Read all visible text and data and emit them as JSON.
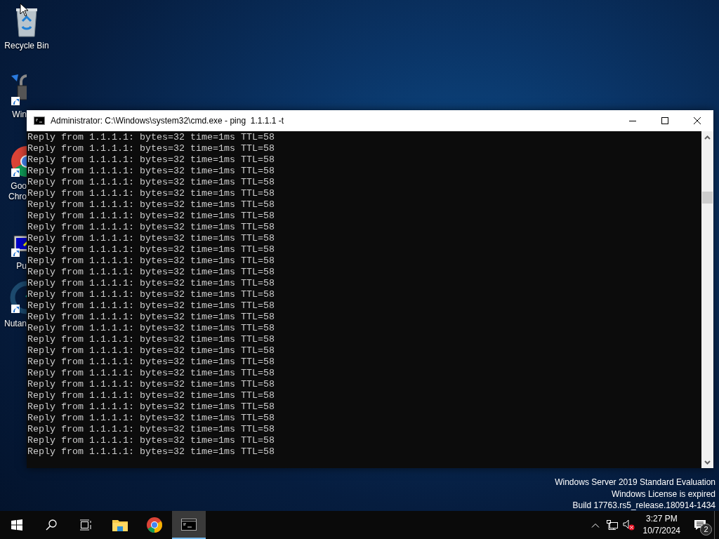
{
  "desktop_icons": [
    {
      "kind": "recycle-bin",
      "shortcut": false,
      "lines": [
        "Recycle Bin"
      ]
    },
    {
      "kind": "lock-transfer",
      "shortcut": true,
      "lines": [
        "Win"
      ]
    },
    {
      "kind": "browser",
      "shortcut": true,
      "lines": [
        "Goo",
        "Chro"
      ]
    },
    {
      "kind": "terminal-client",
      "shortcut": true,
      "lines": [
        "Pu"
      ]
    },
    {
      "kind": "ring",
      "shortcut": true,
      "lines": [
        "Nutan"
      ]
    }
  ],
  "window": {
    "title": "Administrator: C:\\Windows\\system32\\cmd.exe - ping  1.1.1.1 -t",
    "lines": [
      "Reply from 1.1.1.1: bytes=32 time=1ms TTL=58",
      "Reply from 1.1.1.1: bytes=32 time=1ms TTL=58",
      "Reply from 1.1.1.1: bytes=32 time=1ms TTL=58",
      "Reply from 1.1.1.1: bytes=32 time=1ms TTL=58",
      "Reply from 1.1.1.1: bytes=32 time=1ms TTL=58",
      "Reply from 1.1.1.1: bytes=32 time=1ms TTL=58",
      "Reply from 1.1.1.1: bytes=32 time=1ms TTL=58",
      "Reply from 1.1.1.1: bytes=32 time=1ms TTL=58",
      "Reply from 1.1.1.1: bytes=32 time=1ms TTL=58",
      "Reply from 1.1.1.1: bytes=32 time=1ms TTL=58",
      "Reply from 1.1.1.1: bytes=32 time=1ms TTL=58",
      "Reply from 1.1.1.1: bytes=32 time=1ms TTL=58",
      "Reply from 1.1.1.1: bytes=32 time=1ms TTL=58",
      "Reply from 1.1.1.1: bytes=32 time=1ms TTL=58",
      "Reply from 1.1.1.1: bytes=32 time=1ms TTL=58",
      "Reply from 1.1.1.1: bytes=32 time=1ms TTL=58",
      "Reply from 1.1.1.1: bytes=32 time=1ms TTL=58",
      "Reply from 1.1.1.1: bytes=32 time=1ms TTL=58",
      "Reply from 1.1.1.1: bytes=32 time=1ms TTL=58",
      "Reply from 1.1.1.1: bytes=32 time=1ms TTL=58",
      "Reply from 1.1.1.1: bytes=32 time=1ms TTL=58",
      "Reply from 1.1.1.1: bytes=32 time=1ms TTL=58",
      "Reply from 1.1.1.1: bytes=32 time=1ms TTL=58",
      "Reply from 1.1.1.1: bytes=32 time=1ms TTL=58",
      "Reply from 1.1.1.1: bytes=32 time=1ms TTL=58",
      "Reply from 1.1.1.1: bytes=32 time=1ms TTL=58",
      "Reply from 1.1.1.1: bytes=32 time=1ms TTL=58",
      "Reply from 1.1.1.1: bytes=32 time=1ms TTL=58",
      "Reply from 1.1.1.1: bytes=32 time=1ms TTL=58"
    ]
  },
  "desktop_notice": [
    "Windows Server 2019 Standard Evaluation",
    "Windows License is expired",
    "Build 17763.rs5_release.180914-1434"
  ],
  "taskbar": {
    "buttons": [
      {
        "kind": "start",
        "selected": false
      },
      {
        "kind": "search",
        "selected": false
      },
      {
        "kind": "task-view",
        "selected": false
      },
      {
        "kind": "folder",
        "selected": false
      },
      {
        "kind": "browser",
        "selected": false
      },
      {
        "kind": "console",
        "selected": true
      }
    ],
    "tray": {
      "sound_muted": true,
      "time": "3:27 PM",
      "date": "10/7/2024",
      "notification_count": "2"
    }
  }
}
